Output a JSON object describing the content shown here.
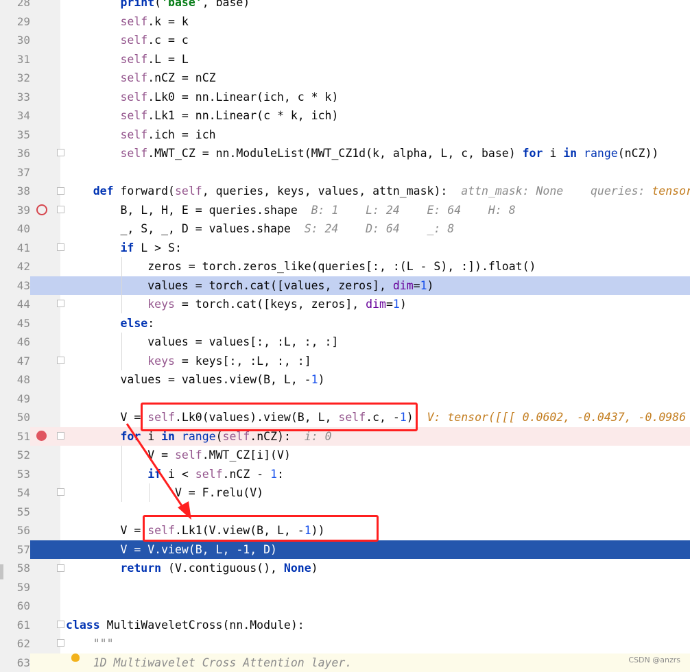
{
  "editor": {
    "lines": [
      {
        "n": "28",
        "html": "        <span class=\"kw\">print</span>(<span class=\"str\">'base'</span>, base)"
      },
      {
        "n": "29",
        "html": "        <span class=\"self\">self</span>.k = k"
      },
      {
        "n": "30",
        "html": "        <span class=\"self\">self</span>.c = c"
      },
      {
        "n": "31",
        "html": "        <span class=\"self\">self</span>.L = L"
      },
      {
        "n": "32",
        "html": "        <span class=\"self\">self</span>.nCZ = nCZ"
      },
      {
        "n": "33",
        "html": "        <span class=\"self\">self</span>.Lk0 = nn.Linear(ich, c * k)"
      },
      {
        "n": "34",
        "html": "        <span class=\"self\">self</span>.Lk1 = nn.Linear(c * k, ich)"
      },
      {
        "n": "35",
        "html": "        <span class=\"self\">self</span>.ich = ich"
      },
      {
        "n": "36",
        "html": "        <span class=\"self\">self</span>.MWT_CZ = nn.ModuleList(MWT_CZ1d(k, alpha, L, c, base) <span class=\"kw\">for</span> i <span class=\"kw\">in</span> <span class=\"kw\" style=\"font-weight:normal\">range</span>(nCZ))"
      },
      {
        "n": "37",
        "html": ""
      },
      {
        "n": "38",
        "html": "    <span class=\"kw\">def</span> forward(<span class=\"self\">self</span>, queries, keys, values, attn_mask):  <span class=\"hint\">attn_mask: None    queries: </span><span class=\"hint-val\">tensor</span>"
      },
      {
        "n": "39",
        "html": "        B, L, H, E = queries.shape  <span class=\"hint\">B: 1    L: 24    E: 64    H: 8</span>"
      },
      {
        "n": "40",
        "html": "        _, S, _, D = values.shape  <span class=\"hint\">S: 24    D: 64    _: 8</span>"
      },
      {
        "n": "41",
        "html": "        <span class=\"kw\">if</span> L > S:"
      },
      {
        "n": "42",
        "html": "            zeros = torch.zeros_like(queries[:, :(L - S), :]).float()"
      },
      {
        "n": "43",
        "html": "            values = torch.cat([values, zeros], <span class=\"param\">dim</span>=<span class=\"num\">1</span>)"
      },
      {
        "n": "44",
        "html": "            <span class=\"self\">keys</span> = torch.cat([keys, zeros], <span class=\"param\">dim</span>=<span class=\"num\">1</span>)"
      },
      {
        "n": "45",
        "html": "        <span class=\"kw\">else</span>:"
      },
      {
        "n": "46",
        "html": "            values = values[:, :L, :, :]"
      },
      {
        "n": "47",
        "html": "            <span class=\"self\">keys</span> = keys[:, :L, :, :]"
      },
      {
        "n": "48",
        "html": "        values = values.view(B, L, -<span class=\"num\">1</span>)"
      },
      {
        "n": "49",
        "html": ""
      },
      {
        "n": "50",
        "html": "        V = <span class=\"self\">self</span>.Lk0(values).view(B, L, <span class=\"self\">self</span>.c, -<span class=\"num\">1</span>)  <span class=\"hint-val\">V: tensor([[[ 0.0602, -0.0437, -0.0986</span>"
      },
      {
        "n": "51",
        "html": "        <span class=\"kw\">for</span> i <span class=\"kw\">in</span> <span class=\"kw\" style=\"font-weight:normal\">range</span>(<span class=\"self\">self</span>.nCZ):  <span class=\"hint\">i: 0</span>"
      },
      {
        "n": "52",
        "html": "            V = <span class=\"self\">self</span>.MWT_CZ[i](V)"
      },
      {
        "n": "53",
        "html": "            <span class=\"kw\">if</span> i < <span class=\"self\">self</span>.nCZ - <span class=\"num\">1</span>:"
      },
      {
        "n": "54",
        "html": "                V = F.relu(V)"
      },
      {
        "n": "55",
        "html": ""
      },
      {
        "n": "56",
        "html": "        V = <span class=\"self\">self</span>.Lk1(V.view(B, L, -<span class=\"num\">1</span>))"
      },
      {
        "n": "57",
        "html": "        V = V.view(B, L, -1, D)"
      },
      {
        "n": "58",
        "html": "        <span class=\"kw\">return</span> (V.contiguous(), <span class=\"kw\">None</span>)"
      },
      {
        "n": "59",
        "html": ""
      },
      {
        "n": "60",
        "html": ""
      },
      {
        "n": "61",
        "html": "<span class=\"kw\">class</span> MultiWaveletCross(nn.Module):"
      },
      {
        "n": "62",
        "html": "    <span class=\"doc\">\"\"\"</span>"
      },
      {
        "n": "63",
        "html": "    <span class=\"doc\">1D Multiwavelet Cross Attention layer.</span>"
      }
    ]
  },
  "annotations": {
    "box_colors": "#ff1f1f"
  },
  "watermark": "CSDN @anzrs"
}
